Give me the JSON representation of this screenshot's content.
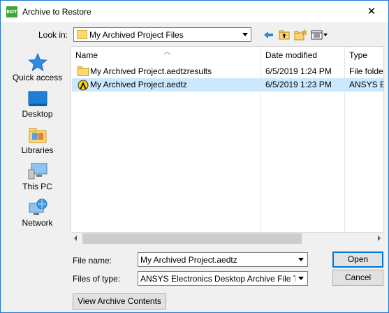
{
  "window": {
    "title": "Archive to Restore",
    "app_icon_text": "EDT",
    "close_glyph": "✕"
  },
  "lookin": {
    "label": "Look in:",
    "value": "My Archived Project Files"
  },
  "places": [
    {
      "label": "Quick access",
      "icon": "quick-access-star-icon"
    },
    {
      "label": "Desktop",
      "icon": "desktop-icon"
    },
    {
      "label": "Libraries",
      "icon": "libraries-icon"
    },
    {
      "label": "This PC",
      "icon": "this-pc-icon"
    },
    {
      "label": "Network",
      "icon": "network-icon"
    }
  ],
  "columns": {
    "name": "Name",
    "date": "Date modified",
    "type": "Type"
  },
  "files": [
    {
      "name": "My Archived Project.aedtzresults",
      "date": "6/5/2019 1:24 PM",
      "type": "File folder",
      "icon": "folder-icon",
      "selected": false
    },
    {
      "name": "My Archived Project.aedtz",
      "date": "6/5/2019 1:23 PM",
      "type": "ANSYS Ele",
      "icon": "ansys-file-icon",
      "selected": true
    }
  ],
  "filename": {
    "label": "File name:",
    "value": "My Archived Project.aedtz"
  },
  "filetype": {
    "label": "Files of type:",
    "value": "ANSYS Electronics Desktop Archive File Types"
  },
  "buttons": {
    "open": "Open",
    "cancel": "Cancel",
    "view_archive": "View Archive Contents"
  },
  "colors": {
    "accent": "#0078d7",
    "selection": "#cce8ff",
    "folder": "#ffd76e"
  }
}
